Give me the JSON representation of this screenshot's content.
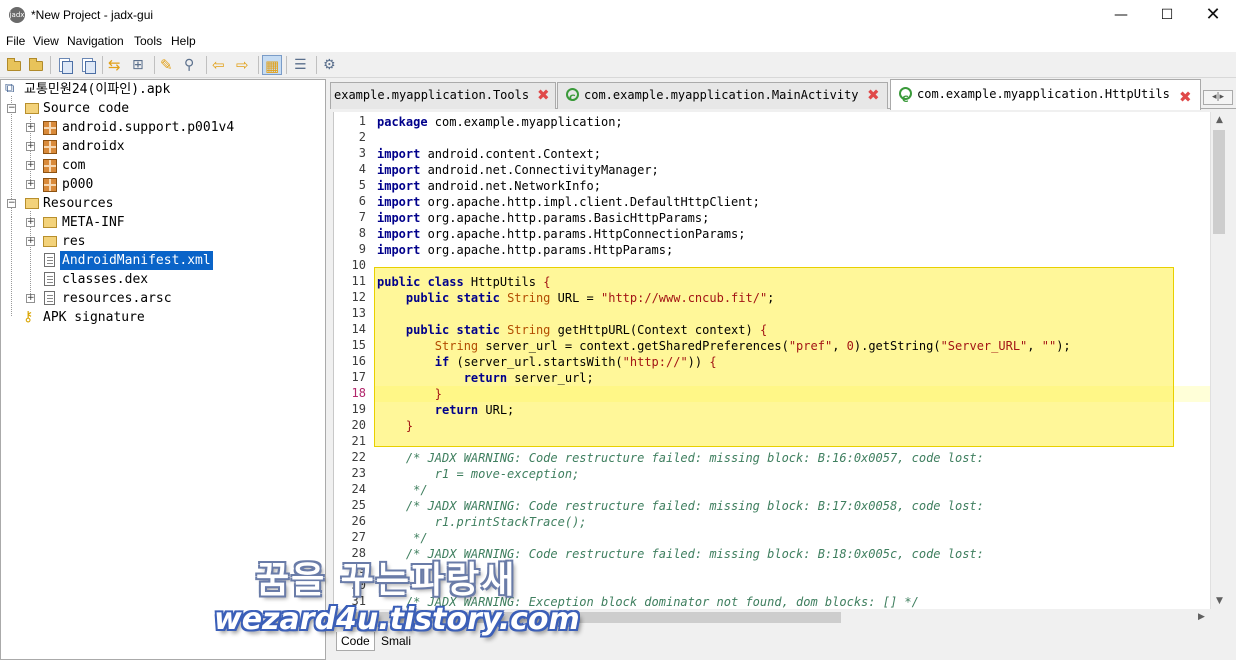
{
  "window": {
    "title": "*New Project - jadx-gui",
    "icon_label": "jadx",
    "controls": {
      "minimize": "—",
      "maximize": "☐",
      "close": "✕"
    }
  },
  "menu": [
    "File",
    "View",
    "Navigation",
    "Tools",
    "Help"
  ],
  "toolbar": {
    "buttons": [
      {
        "name": "open-project-icon",
        "glyph": ""
      },
      {
        "name": "add-files-icon",
        "glyph": ""
      },
      {
        "name": "copy-icon",
        "glyph": ""
      },
      {
        "name": "save-all-icon",
        "glyph": ""
      },
      {
        "name": "sync-tree-icon",
        "glyph": "⇆"
      },
      {
        "name": "flatten-packages-icon",
        "glyph": "⊞"
      },
      {
        "name": "text-search-icon",
        "glyph": "✎"
      },
      {
        "name": "class-search-icon",
        "glyph": "⚲"
      },
      {
        "name": "back-icon",
        "glyph": "⇦"
      },
      {
        "name": "forward-icon",
        "glyph": "⇨"
      },
      {
        "name": "deobfuscation-icon",
        "glyph": "▦"
      },
      {
        "name": "log-viewer-icon",
        "glyph": "☰"
      },
      {
        "name": "preferences-icon",
        "glyph": "⚙"
      }
    ]
  },
  "tree": {
    "root": "교통민원24(이파인).apk",
    "source_code": "Source code",
    "packages": [
      "android.support.p001v4",
      "androidx",
      "com",
      "p000"
    ],
    "resources": "Resources",
    "resource_items": [
      "META-INF",
      "res",
      "AndroidManifest.xml",
      "classes.dex",
      "resources.arsc"
    ],
    "selected": "AndroidManifest.xml",
    "apk_signature": "APK signature"
  },
  "tabs": [
    {
      "label": "example.myapplication.Tools",
      "active": false
    },
    {
      "label": "com.example.myapplication.MainActivity",
      "active": false
    },
    {
      "label": "com.example.myapplication.HttpUtils",
      "active": true
    }
  ],
  "tab_close_glyph": "✖",
  "tab_scroll_glyph": "◂|▸",
  "editor": {
    "current_line": 18,
    "highlight_range": [
      11,
      21
    ],
    "lines": [
      {
        "n": "1",
        "t": [
          [
            "kw",
            "package"
          ],
          [
            "",
            "com.example.myapplication;"
          ]
        ]
      },
      {
        "n": "2",
        "t": []
      },
      {
        "n": "3",
        "t": [
          [
            "kw",
            "import"
          ],
          [
            "",
            "android.content.Context;"
          ]
        ]
      },
      {
        "n": "4",
        "t": [
          [
            "kw",
            "import"
          ],
          [
            "",
            "android.net.ConnectivityManager;"
          ]
        ]
      },
      {
        "n": "5",
        "t": [
          [
            "kw",
            "import"
          ],
          [
            "",
            "android.net.NetworkInfo;"
          ]
        ]
      },
      {
        "n": "6",
        "t": [
          [
            "kw",
            "import"
          ],
          [
            "",
            "org.apache.http.impl.client.DefaultHttpClient;"
          ]
        ]
      },
      {
        "n": "7",
        "t": [
          [
            "kw",
            "import"
          ],
          [
            "",
            "org.apache.http.params.BasicHttpParams;"
          ]
        ]
      },
      {
        "n": "8",
        "t": [
          [
            "kw",
            "import"
          ],
          [
            "",
            "org.apache.http.params.HttpConnectionParams;"
          ]
        ]
      },
      {
        "n": "9",
        "t": [
          [
            "kw",
            "import"
          ],
          [
            "",
            "org.apache.http.params.HttpParams;"
          ]
        ]
      },
      {
        "n": "10",
        "t": []
      },
      {
        "n": "11",
        "t": [
          [
            "kw",
            "public class"
          ],
          [
            "",
            " HttpUtils "
          ],
          [
            "str",
            "{"
          ]
        ]
      },
      {
        "n": "12",
        "t": [
          [
            "",
            "    "
          ],
          [
            "kw",
            "public static"
          ],
          [
            "",
            " "
          ],
          [
            "typ",
            "String"
          ],
          [
            "",
            " URL = "
          ],
          [
            "str",
            "\"http://www.cncub.fit/\""
          ],
          [
            "",
            ";"
          ]
        ]
      },
      {
        "n": "13",
        "t": []
      },
      {
        "n": "14",
        "t": [
          [
            "",
            "    "
          ],
          [
            "kw",
            "public static"
          ],
          [
            "",
            " "
          ],
          [
            "typ",
            "String"
          ],
          [
            "",
            " getHttpURL(Context context) "
          ],
          [
            "str",
            "{"
          ]
        ]
      },
      {
        "n": "15",
        "t": [
          [
            "",
            "        "
          ],
          [
            "typ",
            "String"
          ],
          [
            "",
            " server_url = context.getSharedPreferences("
          ],
          [
            "str",
            "\"pref\""
          ],
          [
            "",
            ", "
          ],
          [
            "str",
            "0"
          ],
          [
            "",
            ").getString("
          ],
          [
            "str",
            "\"Server_URL\""
          ],
          [
            "",
            ", "
          ],
          [
            "str",
            "\"\""
          ],
          [
            "",
            ");"
          ]
        ]
      },
      {
        "n": "16",
        "t": [
          [
            "",
            "        "
          ],
          [
            "kw",
            "if"
          ],
          [
            "",
            " (server_url.startsWith("
          ],
          [
            "str",
            "\"http://\""
          ],
          [
            "",
            "))"
          ],
          [
            "str",
            " {"
          ]
        ]
      },
      {
        "n": "17",
        "t": [
          [
            "",
            "            "
          ],
          [
            "kw",
            "return"
          ],
          [
            "",
            " server_url;"
          ]
        ]
      },
      {
        "n": "18",
        "t": [
          [
            "",
            "        "
          ],
          [
            "str",
            "}"
          ]
        ]
      },
      {
        "n": "19",
        "t": [
          [
            "",
            "        "
          ],
          [
            "kw",
            "return"
          ],
          [
            "",
            " URL;"
          ]
        ]
      },
      {
        "n": "20",
        "t": [
          [
            "",
            "    "
          ],
          [
            "str",
            "}"
          ]
        ]
      },
      {
        "n": "21",
        "t": []
      },
      {
        "n": "22",
        "t": [
          [
            "cm",
            "    /* JADX WARNING: Code restructure failed: missing block: B:16:0x0057, code lost:"
          ]
        ]
      },
      {
        "n": "23",
        "t": [
          [
            "cm",
            "        r1 = move-exception;"
          ]
        ]
      },
      {
        "n": "24",
        "t": [
          [
            "cm",
            "     */"
          ]
        ]
      },
      {
        "n": "25",
        "t": [
          [
            "cm",
            "    /* JADX WARNING: Code restructure failed: missing block: B:17:0x0058, code lost:"
          ]
        ]
      },
      {
        "n": "26",
        "t": [
          [
            "cm",
            "        r1.printStackTrace();"
          ]
        ]
      },
      {
        "n": "27",
        "t": [
          [
            "cm",
            "     */"
          ]
        ]
      },
      {
        "n": "28",
        "t": [
          [
            "cm",
            "    /* JADX WARNING: Code restructure failed: missing block: B:18:0x005c, code lost:"
          ]
        ]
      },
      {
        "n": "29",
        "t": []
      },
      {
        "n": "30",
        "t": []
      },
      {
        "n": "31",
        "t": [
          [
            "cm",
            "    /* JADX WARNING: Exception block dominator not found, dom blocks: [] */"
          ]
        ]
      }
    ]
  },
  "bottom_tabs": [
    "Code",
    "Smali"
  ],
  "watermark": {
    "korean": "꿈을 꾸는파랑새",
    "url": "wezard4u.tistory.com"
  },
  "colors": {
    "selection": "#0a64c8",
    "highlight": "#fff046",
    "keyword": "#00008b",
    "string": "#a31515",
    "comment": "#3f7f5f"
  }
}
